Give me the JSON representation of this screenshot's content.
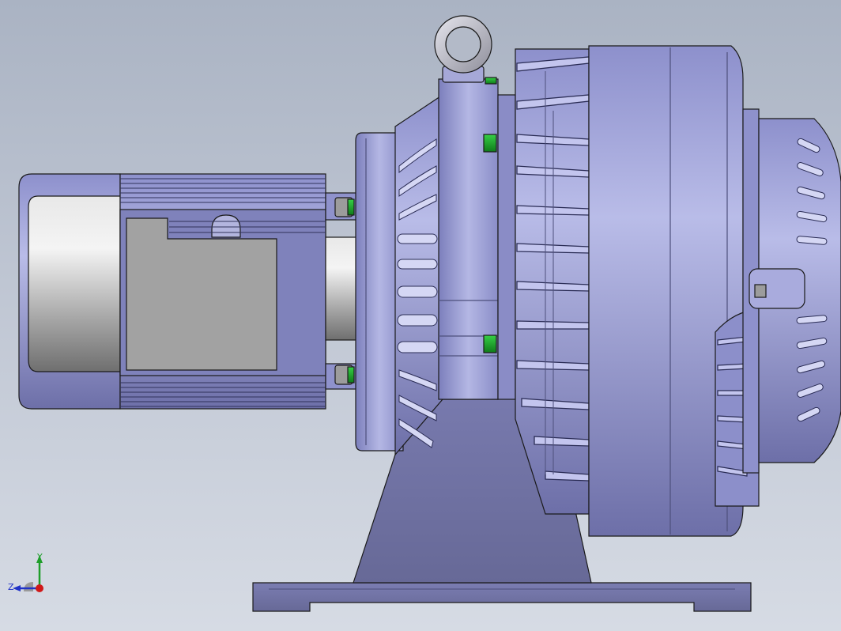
{
  "triad": {
    "y_label": "Y",
    "z_label": "Z",
    "y_color": "#1f9e2a",
    "z_color": "#2032c8",
    "x_color": "#d01818"
  },
  "colors": {
    "bg_top": "#aab3c3",
    "bg_bottom": "#d6dbe4",
    "body_lavender": "#9b9ed6",
    "body_dark": "#6e6fa6",
    "motor_grey": "#b6b6b6",
    "terminal_box": "#a0a0a0",
    "bolt_green": "#1da32a",
    "outline": "#1a1a1a"
  },
  "icons": [
    "lifting-eye-bolt-icon",
    "coordinate-triad-icon"
  ]
}
